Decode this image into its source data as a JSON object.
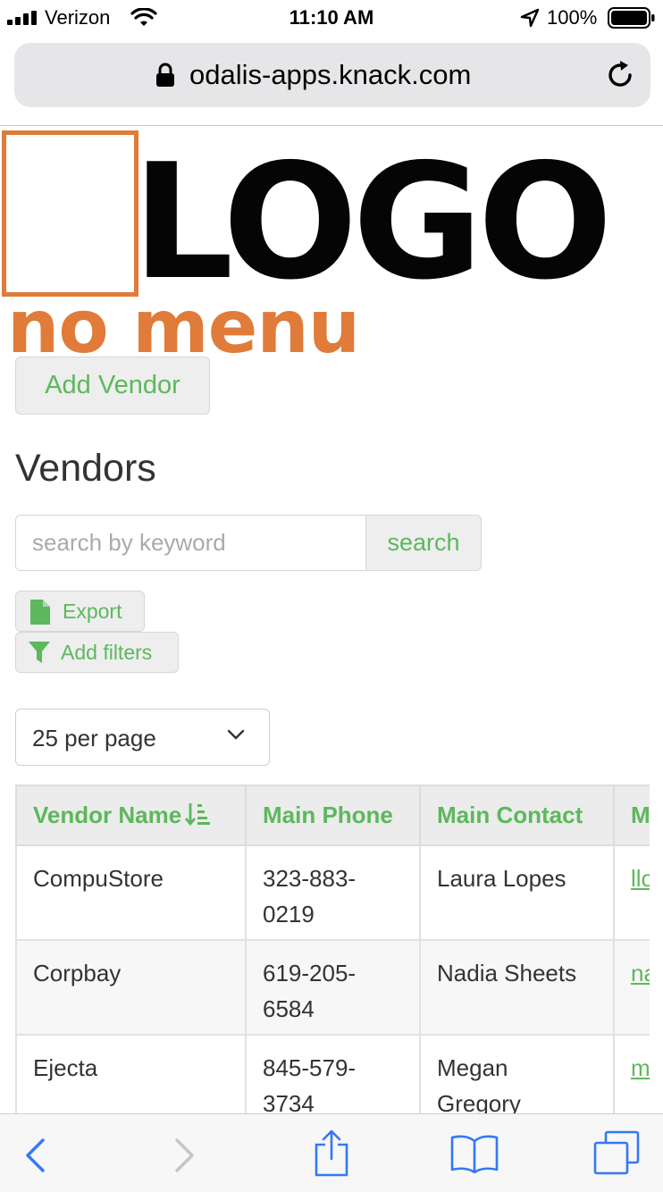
{
  "status_bar": {
    "carrier": "Verizon",
    "time": "11:10 AM",
    "battery": "100%"
  },
  "browser": {
    "url": "odalis-apps.knack.com"
  },
  "logo": {
    "text": "LOGO"
  },
  "annotation": {
    "text": "no menu",
    "color": "#e07b39"
  },
  "page": {
    "add_button": "Add Vendor",
    "title": "Vendors",
    "search_placeholder": "search by keyword",
    "search_button": "search",
    "export_button": "Export",
    "filters_button": "Add filters",
    "per_page": "25 per page",
    "accent_color": "#5cb85c"
  },
  "table": {
    "columns": [
      "Vendor Name",
      "Main Phone",
      "Main Contact",
      "M"
    ],
    "rows": [
      {
        "name": "CompuStore",
        "phone_line1": "323-883-",
        "phone_line2": "0219",
        "contact_line1": "Laura Lopes",
        "contact_line2": "",
        "email": "llo"
      },
      {
        "name": "Corpbay",
        "phone_line1": "619-205-",
        "phone_line2": "6584",
        "contact_line1": "Nadia Sheets",
        "contact_line2": "",
        "email": "na"
      },
      {
        "name": "Ejecta",
        "phone_line1": "845-579-",
        "phone_line2": "3734",
        "contact_line1": "Megan",
        "contact_line2": "Gregory",
        "email": "m"
      }
    ]
  },
  "icons": {
    "signal": "signal-bars-icon",
    "wifi": "wifi-icon",
    "location": "location-arrow-icon",
    "battery": "battery-icon",
    "lock": "lock-icon",
    "reload": "reload-icon",
    "export": "file-icon",
    "filter": "filter-icon",
    "sort": "sort-icon",
    "back": "back-icon",
    "forward": "forward-icon",
    "share": "share-icon",
    "bookmarks": "bookmarks-icon",
    "tabs": "tabs-icon"
  }
}
